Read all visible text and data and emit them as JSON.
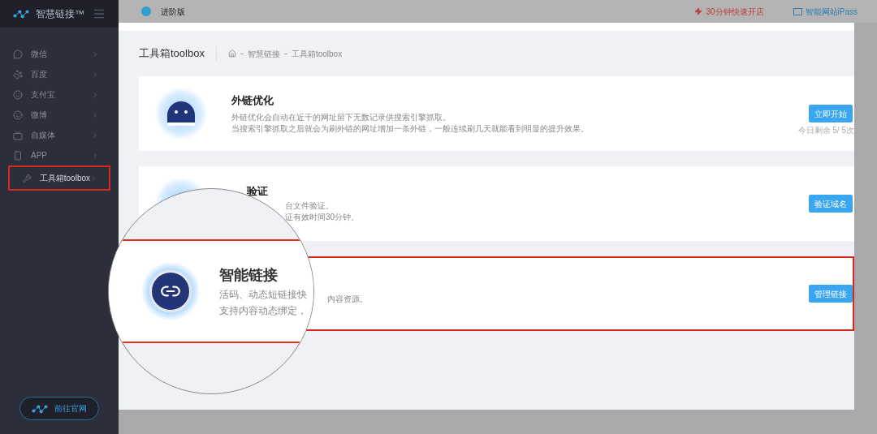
{
  "brand": {
    "name": "智慧链接™"
  },
  "sidebar": {
    "items": [
      {
        "label": "微信",
        "highlighted": false
      },
      {
        "label": "百度",
        "highlighted": false
      },
      {
        "label": "支付宝",
        "highlighted": false
      },
      {
        "label": "微博",
        "highlighted": false
      },
      {
        "label": "自媒体",
        "highlighted": false
      },
      {
        "label": "APP",
        "highlighted": false
      },
      {
        "label": "工具箱toolbox",
        "highlighted": true
      }
    ],
    "footer_button": "前往官网"
  },
  "topbar": {
    "edition": "进阶版",
    "promo": "30分钟快速开店",
    "site_link": "智能网站iPass"
  },
  "page": {
    "title": "工具箱toolbox",
    "breadcrumb": [
      "智慧链接",
      "工具箱toolbox"
    ]
  },
  "cards": [
    {
      "kind": "full",
      "title": "外链优化",
      "lines": [
        "外链优化会自动在近千的网址留下无数记录供搜索引擎抓取。",
        "当搜索引擎抓取之后就会为刷外链的网址增加一条外链，一般连续刷几天就能看到明显的提升效果。"
      ],
      "button": "立即开始",
      "note": "今日剩余 5/ 5次",
      "highlighted": false
    },
    {
      "kind": "covered_left",
      "title": "验证",
      "lines": [
        "台文件验证。",
        "证有效时间30分钟。"
      ],
      "button": "验证域名",
      "highlighted": false
    },
    {
      "kind": "covered",
      "lines": [
        "内容资源。"
      ],
      "button": "管理链接",
      "highlighted": true
    }
  ],
  "magnifier": {
    "title": "智能链接",
    "lines": [
      "活码、动态短链接快",
      "支持内容动态绑定，"
    ]
  }
}
